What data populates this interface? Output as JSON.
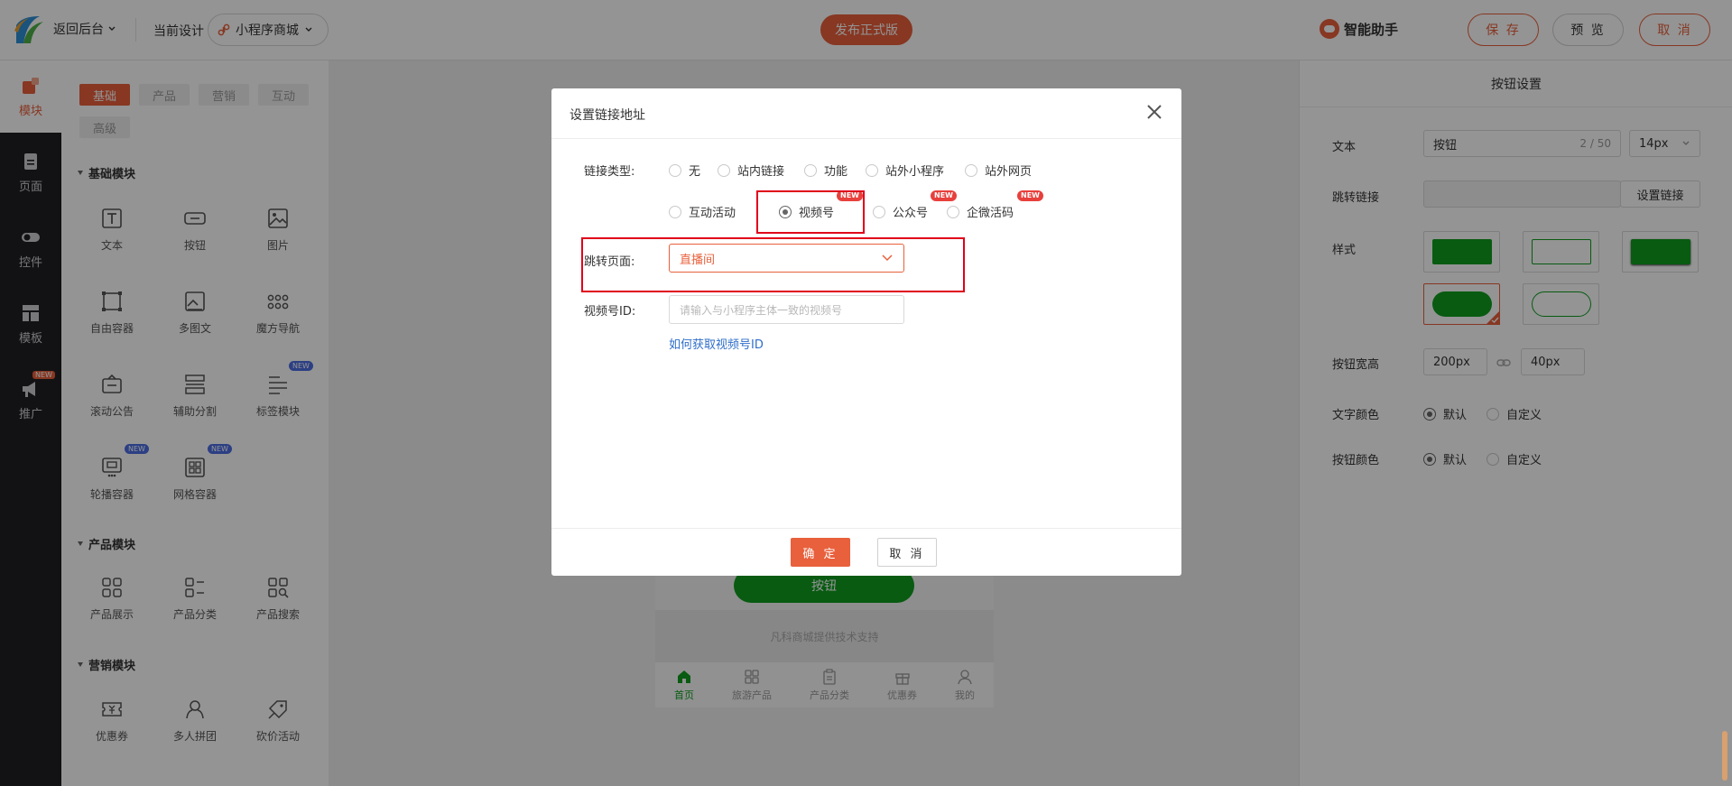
{
  "topbar": {
    "back_label": "返回后台",
    "current_design_label": "当前设计",
    "design_name": "小程序商城",
    "publish_label": "发布正式版",
    "ai_helper_label": "智能助手",
    "save_label": "保 存",
    "preview_label": "预 览",
    "cancel_label": "取 消"
  },
  "leftnav": {
    "items": [
      {
        "label": "模块",
        "icon": "module-icon"
      },
      {
        "label": "页面",
        "icon": "page-icon"
      },
      {
        "label": "控件",
        "icon": "toggle-icon"
      },
      {
        "label": "模板",
        "icon": "template-icon"
      },
      {
        "label": "推广",
        "icon": "megaphone-icon"
      }
    ],
    "promo_badge": "NEW"
  },
  "components": {
    "tabs": [
      "基础",
      "产品",
      "营销",
      "互动",
      "高级"
    ],
    "active_tab": "基础",
    "sections": [
      {
        "title": "基础模块",
        "items": [
          {
            "label": "文本",
            "icon": "text-icon"
          },
          {
            "label": "按钮",
            "icon": "button-icon"
          },
          {
            "label": "图片",
            "icon": "image-icon"
          },
          {
            "label": "自由容器",
            "icon": "free-container-icon"
          },
          {
            "label": "多图文",
            "icon": "multi-image-icon"
          },
          {
            "label": "魔方导航",
            "icon": "cube-nav-icon"
          },
          {
            "label": "滚动公告",
            "icon": "scroll-notice-icon"
          },
          {
            "label": "辅助分割",
            "icon": "divider-icon"
          },
          {
            "label": "标签模块",
            "icon": "tag-module-icon",
            "badge": "NEW"
          },
          {
            "label": "轮播容器",
            "icon": "carousel-icon",
            "badge": "NEW"
          },
          {
            "label": "网格容器",
            "icon": "grid-container-icon",
            "badge": "NEW"
          }
        ]
      },
      {
        "title": "产品模块",
        "items": [
          {
            "label": "产品展示",
            "icon": "product-display-icon"
          },
          {
            "label": "产品分类",
            "icon": "product-category-icon"
          },
          {
            "label": "产品搜索",
            "icon": "product-search-icon"
          }
        ]
      },
      {
        "title": "营销模块",
        "items": [
          {
            "label": "优惠券",
            "icon": "coupon-icon"
          },
          {
            "label": "多人拼团",
            "icon": "group-buy-icon"
          },
          {
            "label": "砍价活动",
            "icon": "bargain-icon"
          }
        ]
      }
    ]
  },
  "phone": {
    "button_label": "按钮",
    "support_text": "凡科商城提供技术支持",
    "tabbar": [
      {
        "label": "首页",
        "icon": "home-icon",
        "active": true
      },
      {
        "label": "旅游产品",
        "icon": "grid-icon"
      },
      {
        "label": "产品分类",
        "icon": "clipboard-icon"
      },
      {
        "label": "优惠券",
        "icon": "gift-icon"
      },
      {
        "label": "我的",
        "icon": "user-icon"
      }
    ]
  },
  "right_panel": {
    "title": "按钮设置",
    "text_label": "文本",
    "text_value": "按钮",
    "text_count": "2 / 50",
    "font_size": "14px",
    "link_label": "跳转链接",
    "set_link_label": "设置链接",
    "style_label": "样式",
    "size_label": "按钮宽高",
    "width_value": "200px",
    "height_value": "40px",
    "text_color_label": "文字颜色",
    "button_color_label": "按钮颜色",
    "default_label": "默认",
    "custom_label": "自定义",
    "accent_color": "#0e9e1e"
  },
  "modal": {
    "title": "设置链接地址",
    "link_type_label": "链接类型:",
    "link_types_row1": [
      "无",
      "站内链接",
      "功能",
      "站外小程序",
      "站外网页"
    ],
    "link_types_row2": [
      "互动活动",
      "视频号",
      "公众号",
      "企微活码"
    ],
    "selected_type": "视频号",
    "new_badge": "NEW",
    "jump_page_label": "跳转页面:",
    "jump_page_value": "直播间",
    "channel_id_label": "视频号ID:",
    "channel_id_placeholder": "请输入与小程序主体一致的视频号",
    "help_link": "如何获取视频号ID",
    "confirm_label": "确 定",
    "cancel_label": "取 消"
  },
  "colors": {
    "brand": "#e8603c",
    "highlight_box": "#e0001a",
    "link": "#2f6ec9"
  }
}
